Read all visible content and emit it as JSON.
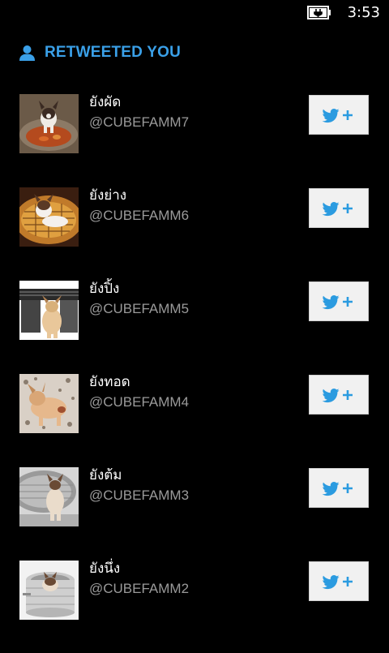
{
  "status": {
    "time": "3:53",
    "battery_icon": "battery-charging-icon"
  },
  "header": {
    "icon": "person-icon",
    "title": "RETWEETED YOU",
    "accent_color": "#3aa0e8"
  },
  "users": [
    {
      "name": "ยังผัด",
      "handle": "@CUBEFAMM7",
      "avatar_icon": "dog-photo"
    },
    {
      "name": "ยังย่าง",
      "handle": "@CUBEFAMM6",
      "avatar_icon": "dog-photo"
    },
    {
      "name": "ยังปิ้ง",
      "handle": "@CUBEFAMM5",
      "avatar_icon": "dog-photo"
    },
    {
      "name": "ยังทอด",
      "handle": "@CUBEFAMM4",
      "avatar_icon": "dog-photo"
    },
    {
      "name": "ยังต้ม",
      "handle": "@CUBEFAMM3",
      "avatar_icon": "dog-photo"
    },
    {
      "name": "ยังนึ่ง",
      "handle": "@CUBEFAMM2",
      "avatar_icon": "dog-photo"
    }
  ],
  "follow_button": {
    "icon": "twitter-follow-icon"
  }
}
